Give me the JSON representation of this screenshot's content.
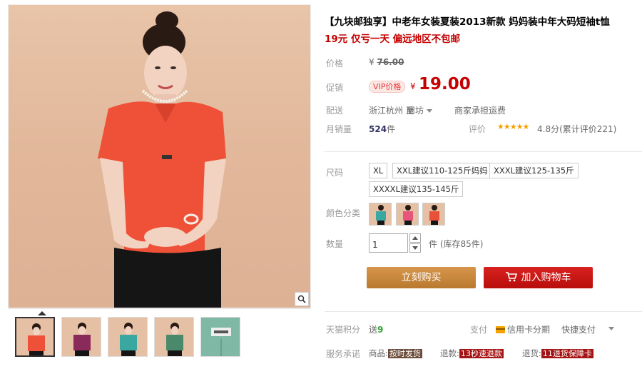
{
  "product": {
    "title": "【九块邮独享】中老年女装夏装2013新款 妈妈装中年大码短袖t恤",
    "subtitle": "19元 仅亏一天 偏远地区不包邮"
  },
  "price": {
    "label": "价格",
    "currency": "¥",
    "original": "76.00"
  },
  "promo": {
    "label": "促销",
    "vip_tag": "VIP价格",
    "currency": "¥",
    "price": "19.00"
  },
  "shipping": {
    "label": "配送",
    "from": "浙江杭州 至",
    "to": "廊坊",
    "note": "商家承担运费"
  },
  "sales": {
    "label": "月销量",
    "count": "524",
    "unit": "件"
  },
  "review": {
    "label": "评价",
    "stars": "★★★★★",
    "star_rating": 4.8,
    "score_text": "4.8分(累计评价221)"
  },
  "size": {
    "label": "尺码",
    "options": [
      "XL",
      "XXL建议110-125斤妈妈",
      "XXXL建议125-135斤",
      "XXXXL建议135-145斤"
    ]
  },
  "color": {
    "label": "颜色分类",
    "options": [
      {
        "name": "teal",
        "hex": "#3aa8a0"
      },
      {
        "name": "pink",
        "hex": "#e8557a"
      },
      {
        "name": "red",
        "hex": "#e8503a"
      }
    ]
  },
  "quantity": {
    "label": "数量",
    "value": "1",
    "unit": "件 (库存85件)"
  },
  "buttons": {
    "buy_now": "立刻购买",
    "add_to_cart": "加入购物车"
  },
  "tmall_points": {
    "label": "天猫积分",
    "prefix": "送",
    "value": "9"
  },
  "payment": {
    "label": "支付",
    "credit_card": "信用卡分期",
    "quick_pay": "快捷支付"
  },
  "service": {
    "label": "服务承诺",
    "items": [
      {
        "prefix": "商品:",
        "badge": "按时发货"
      },
      {
        "prefix": "退款:",
        "badge": "13秒速退款"
      },
      {
        "prefix": "退货:",
        "badge": "11退货保障卡"
      }
    ]
  },
  "colors": {
    "price_red": "#c40000",
    "buy_brown": "#c6863c",
    "cart_red": "#c8100e",
    "shirt_coral": "#ef5138",
    "background_peach": "#e2b79a"
  }
}
